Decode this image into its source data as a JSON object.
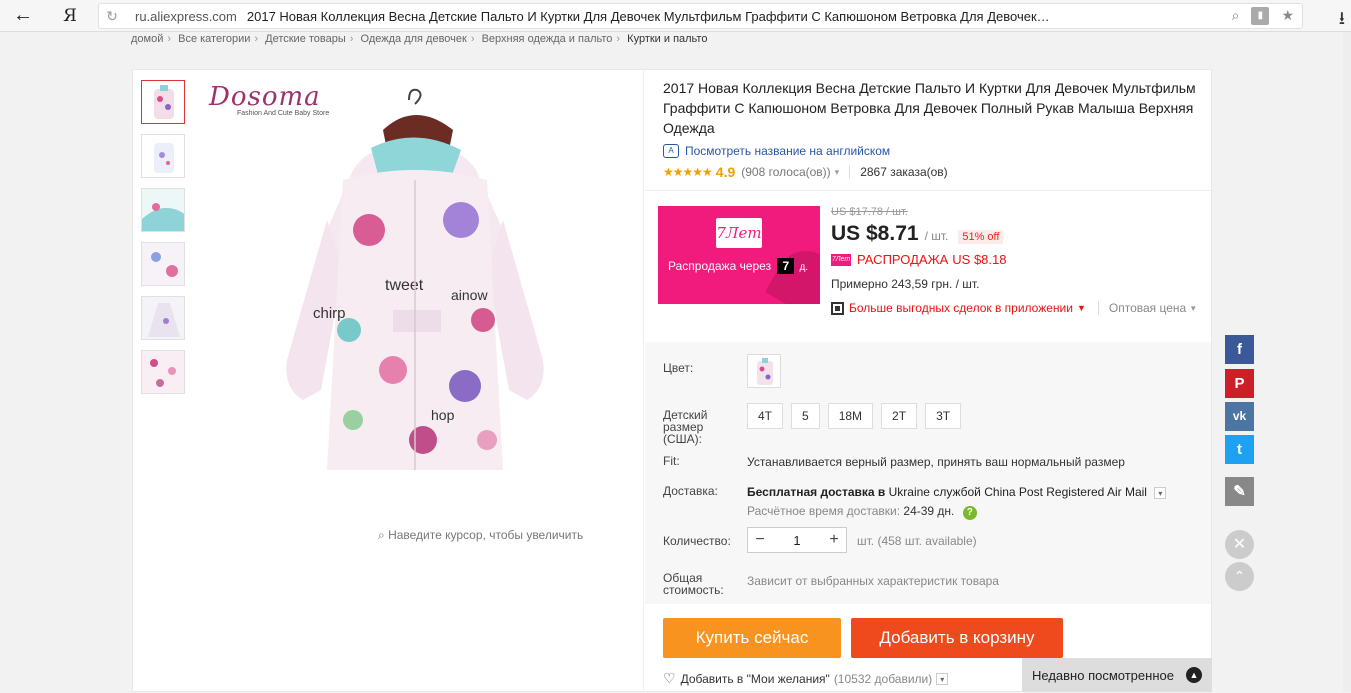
{
  "browser": {
    "back_icon": "arrow-left-icon",
    "yandex_logo": "Я",
    "domain": "ru.aliexpress.com",
    "tab_title": "2017 Новая Коллекция Весна Детские Пальто И Куртки Для Девочек Мультфильм Граффити С Капюшоном Ветровка Для Девочек…"
  },
  "breadcrumb": [
    "домой",
    "Все категории",
    "Детские товары",
    "Одежда для девочек",
    "Верхняя одежда и пальто",
    "Куртки и пальто"
  ],
  "gallery": {
    "brand_name": "Dosoma",
    "brand_tagline": "Fashion And Cute Baby Store",
    "zoom_hint": "Наведите курсор, чтобы увеличить"
  },
  "product": {
    "title": "2017 Новая Коллекция Весна Детские Пальто И Куртки Для Девочек Мультфильм Граффити С Капюшоном Ветровка Для Девочек Полный Рукав Малыша Верхняя Одежда",
    "translate_link": "Посмотреть название на английском",
    "stars": "★★★★★",
    "rating": "4.9",
    "votes": "(908 голоса(ов))",
    "orders": "2867 заказа(ов)"
  },
  "promo": {
    "badge": "7Лет",
    "text": "Распродажа через",
    "days": "7",
    "days_suffix": "д."
  },
  "price": {
    "old": "US $17.78 / шт.",
    "current": "US $8.71",
    "per_unit": "/ шт.",
    "discount": "51% off",
    "sale_label": "РАСПРОДАЖА",
    "sale_price": "US $8.18",
    "approx": "Примерно 243,59 грн. / шт.",
    "app_deals": "Больше выгодных сделок в приложении",
    "wholesale": "Оптовая цена"
  },
  "options": {
    "color_label": "Цвет:",
    "size_label": "Детский размер (США):",
    "sizes": [
      "4T",
      "5",
      "18M",
      "2T",
      "3T"
    ],
    "fit_label": "Fit:",
    "fit_text": "Устанавливается верный размер, принять ваш нормальный размер",
    "shipping_label": "Доставка:",
    "shipping_free": "Бесплатная доставка в",
    "shipping_country": "Ukraine",
    "shipping_service_prefix": "службой",
    "shipping_service": "China Post Registered Air Mail",
    "eta_label": "Расчётное время доставки:",
    "eta_value": "24-39 дн.",
    "quantity_label": "Количество:",
    "quantity_value": "1",
    "quantity_available": "шт. (458 шт. available)",
    "total_label": "Общая стоимость:",
    "total_text": "Зависит от выбранных характеристик товара"
  },
  "actions": {
    "buy_now": "Купить сейчас",
    "add_to_cart": "Добавить в корзину",
    "wishlist": "Добавить в \"Мои желания\"",
    "wishlist_count": "(10532 добавили)"
  },
  "recent": {
    "label": "Недавно посмотренное"
  },
  "social": {
    "facebook": "f",
    "pinterest": "P",
    "vk": "vk",
    "twitter": "t",
    "facebook_color": "#3b5998",
    "pinterest_color": "#cb2027",
    "vk_color": "#4c75a3",
    "twitter_color": "#1da1f2",
    "edit_color": "#888888"
  },
  "colors": {
    "accent_orange": "#f7931e",
    "accent_red": "#ef4a1d",
    "promo_pink": "#f01b7c"
  }
}
